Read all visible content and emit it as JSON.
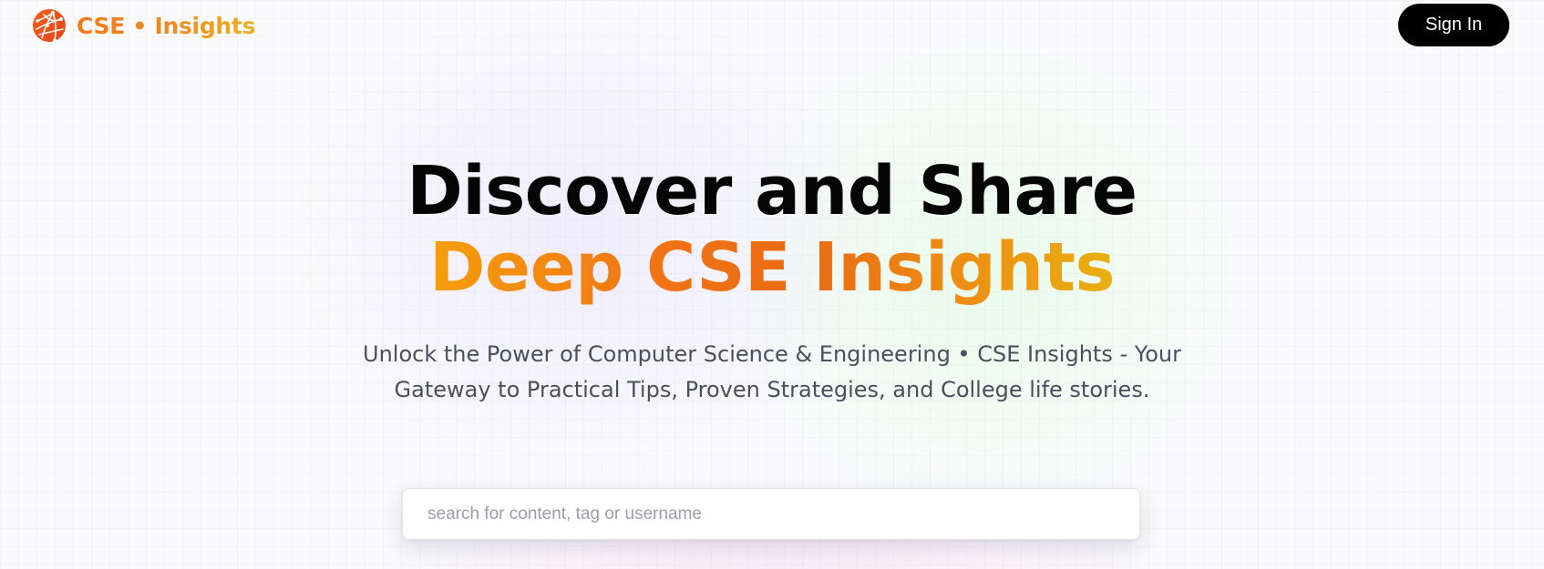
{
  "header": {
    "brand_name": "CSE • Insights",
    "logo_icon": "globe-network-icon",
    "sign_in_label": "Sign In"
  },
  "hero": {
    "title_line1": "Discover and Share",
    "title_line2": "Deep CSE Insights",
    "subtitle_line1": "Unlock the Power of Computer Science & Engineering • CSE Insights - Your",
    "subtitle_line2": "Gateway to Practical Tips, Proven Strategies, and College life stories."
  },
  "search": {
    "placeholder": "search for content, tag or username",
    "value": ""
  },
  "colors": {
    "accent_orange": "#f07215",
    "accent_amber": "#f59e0b",
    "accent_gold": "#e8b00f",
    "button_bg": "#000000",
    "button_text": "#ffffff",
    "title_text": "#050505",
    "subtitle_text": "#4a4f5c"
  }
}
